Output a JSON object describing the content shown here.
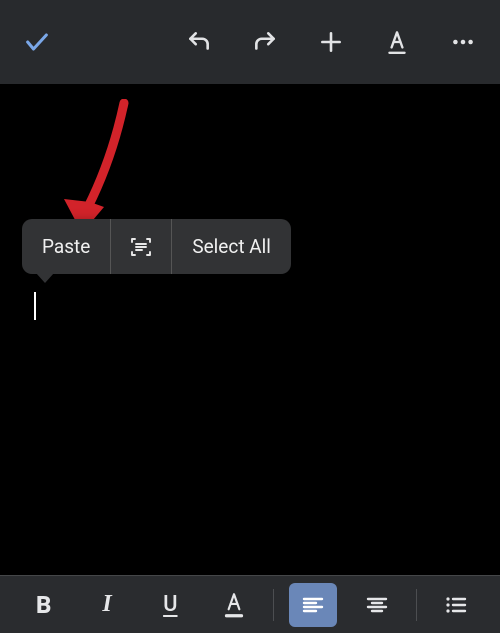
{
  "top_toolbar": {
    "confirm_icon": "check",
    "undo_icon": "undo",
    "redo_icon": "redo",
    "insert_icon": "plus",
    "text_format_icon": "text-format",
    "more_icon": "more"
  },
  "context_menu": {
    "paste_label": "Paste",
    "scan_icon": "scan-text",
    "select_all_label": "Select All"
  },
  "bottom_toolbar": {
    "bold_label": "B",
    "italic_label": "I",
    "underline_label": "U",
    "text_color_label": "A",
    "align_left_icon": "align-left",
    "align_center_icon": "align-center",
    "list_icon": "bulleted-list",
    "active_alignment": "left"
  },
  "annotation": {
    "arrow_color": "#d2232a"
  }
}
